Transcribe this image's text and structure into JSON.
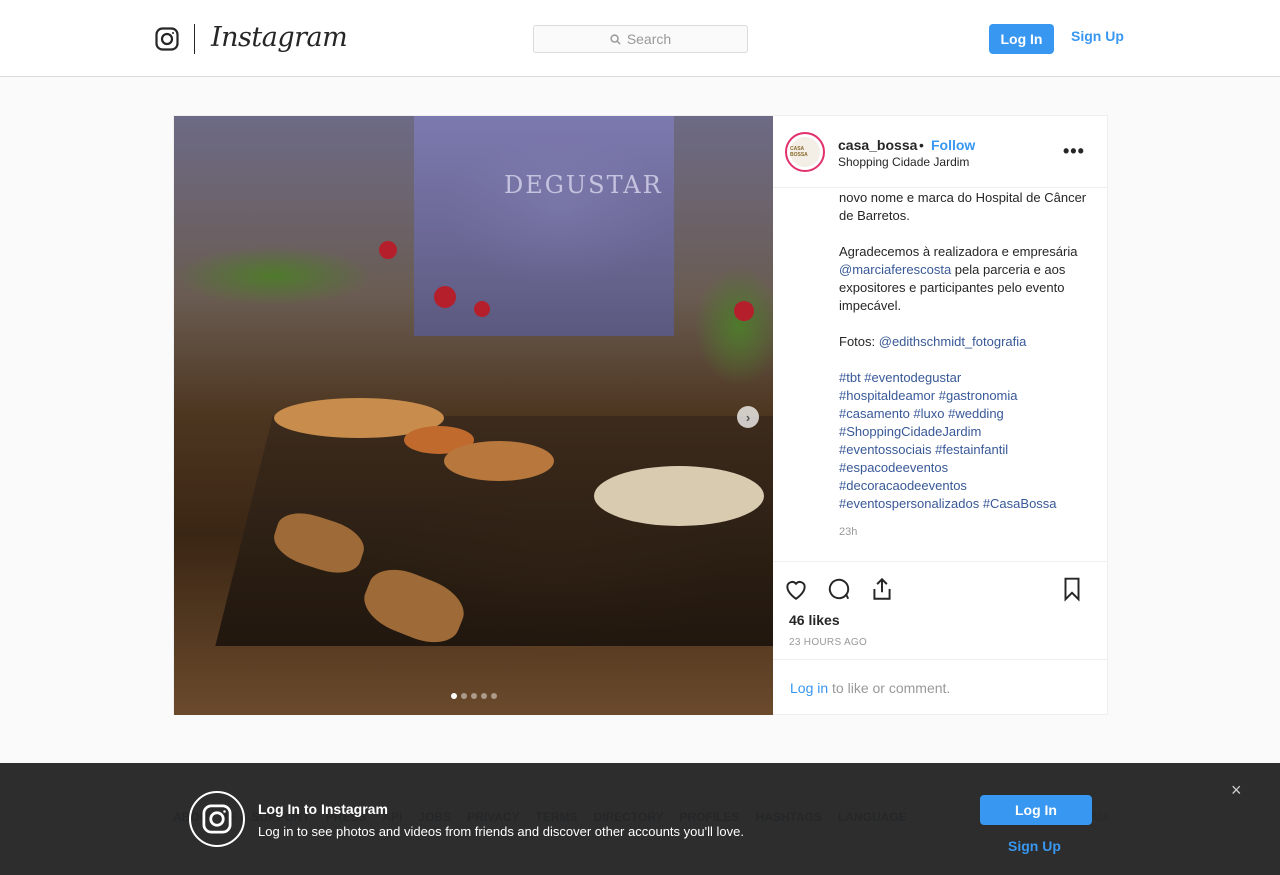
{
  "header": {
    "brand": "Instagram",
    "search_placeholder": "Search",
    "login_label": "Log In",
    "signup_label": "Sign Up"
  },
  "post": {
    "username": "casa_bossa",
    "bullet": "•",
    "follow_label": "Follow",
    "location": "Shopping Cidade Jardim",
    "more_label": "•••",
    "avatar_text": "CASA BOSSA",
    "photo_text": "DEGUSTAR",
    "carousel": {
      "current": 1,
      "total": 5,
      "next_label": "›"
    },
    "caption": {
      "p1": "novo nome e marca do Hospital de Câncer de Barretos.",
      "p2_before": "Agradecemos à realizadora e empresária ",
      "p2_mention": "@marciaferescosta",
      "p2_after": " pela parceria e aos expositores e participantes pelo evento impecável.",
      "p3_label": "Fotos: ",
      "p3_mention": "@edithschmidt_fotografia",
      "hashtags": [
        "#tbt #eventodegustar",
        "#hospitaldeamor #gastronomia",
        "#casamento #luxo #wedding",
        "#ShoppingCidadeJardim",
        "#eventossociais #festainfantil",
        "#espacodeeventos",
        "#decoracaodeeventos",
        "#eventospersonalizados #CasaBossa"
      ],
      "age": "23h"
    },
    "likes": "46 likes",
    "timestamp": "23 HOURS AGO",
    "comment_login": "Log in",
    "comment_rest": " to like or comment."
  },
  "footer": {
    "links": [
      "ABOUT US",
      "SUPPORT",
      "PRESS",
      "API",
      "JOBS",
      "PRIVACY",
      "TERMS",
      "DIRECTORY",
      "PROFILES",
      "HASHTAGS",
      "LANGUAGE"
    ],
    "right_partial": "AM"
  },
  "banner": {
    "title": "Log In to Instagram",
    "subtitle": "Log in to see photos and videos from friends and discover other accounts you'll love.",
    "login_label": "Log In",
    "signup_label": "Sign Up",
    "close_label": "×"
  },
  "colors": {
    "accent": "#3897f0",
    "banner_bg": "#262626",
    "story_ring": "#e1306c"
  }
}
